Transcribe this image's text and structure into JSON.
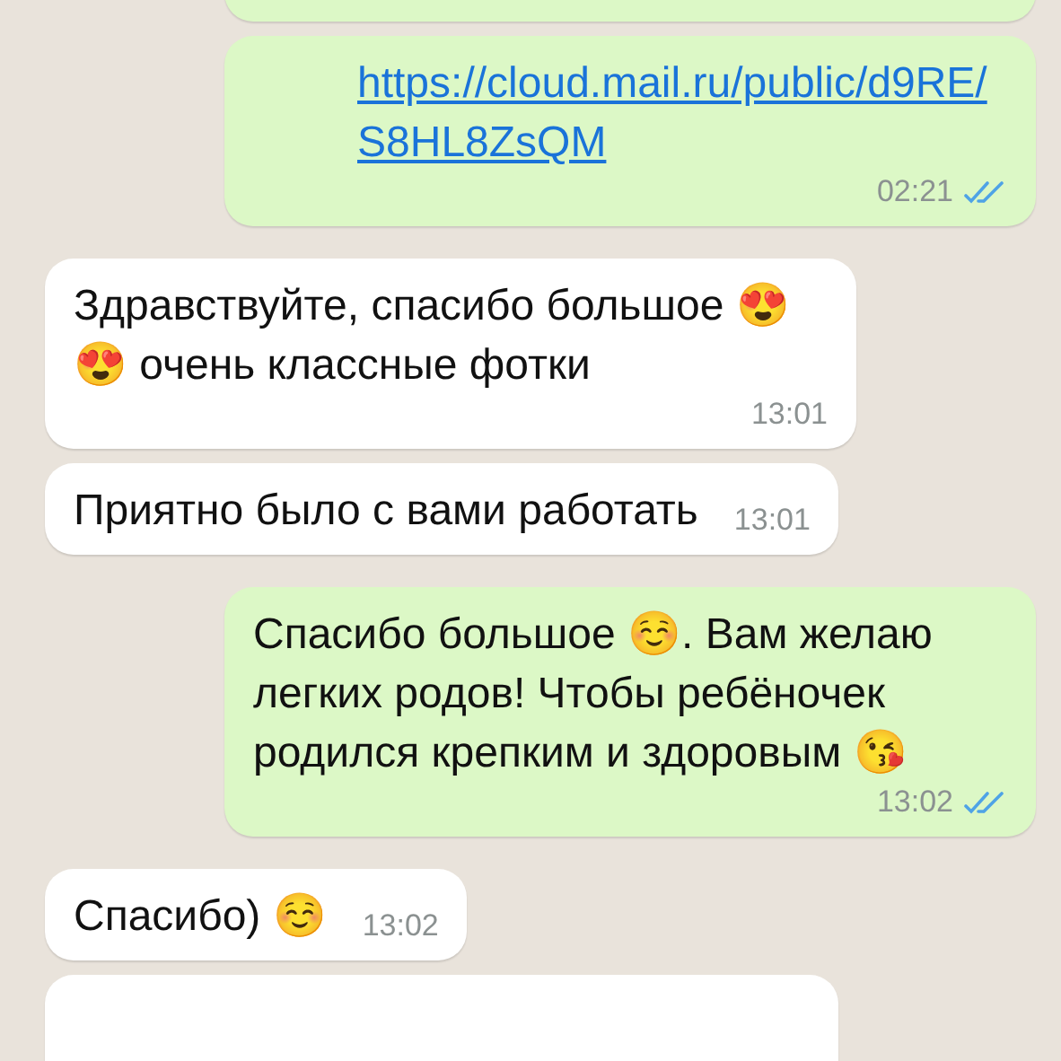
{
  "messages": [
    {
      "outgoing": true,
      "kind": "partial"
    },
    {
      "outgoing": true,
      "kind": "link",
      "text": "https://cloud.mail.ru/public/d9RE/S8HL8ZsQM",
      "time": "02:21",
      "read": true
    },
    {
      "outgoing": false,
      "kind": "text",
      "text": "Здравствуйте, спасибо большое 😍😍 очень классные фотки",
      "time": "13:01"
    },
    {
      "outgoing": false,
      "kind": "text",
      "text": "Приятно было с вами работать",
      "time": "13:01"
    },
    {
      "outgoing": true,
      "kind": "text",
      "text": "Спасибо большое ☺️. Вам желаю легких родов! Чтобы ребёночек родился крепким и здоровым 😘",
      "time": "13:02",
      "read": true
    },
    {
      "outgoing": false,
      "kind": "text",
      "text": "Спасибо) ☺️",
      "time": "13:02"
    },
    {
      "outgoing": false,
      "kind": "partial"
    }
  ]
}
